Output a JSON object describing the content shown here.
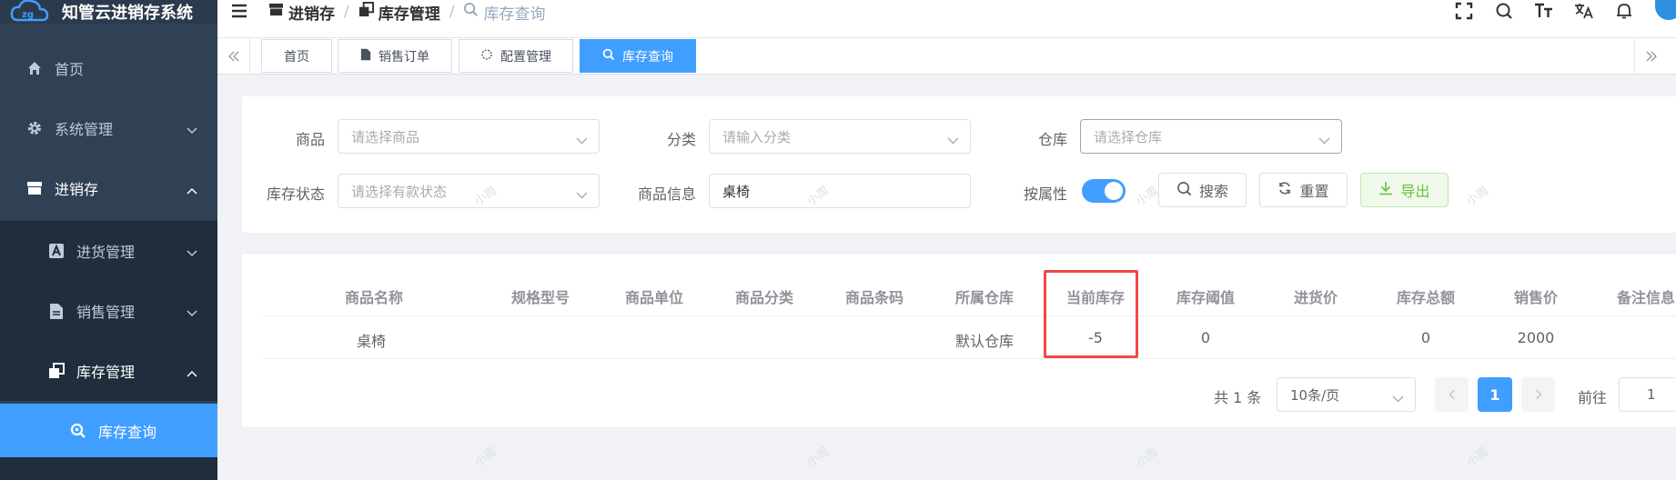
{
  "app": {
    "title": "知管云进销存系统"
  },
  "sidebar": {
    "items": [
      {
        "label": "首页",
        "icon": "home-icon"
      },
      {
        "label": "系统管理",
        "icon": "gear-icon"
      },
      {
        "label": "进销存",
        "icon": "store-icon"
      },
      {
        "label": "进货管理",
        "icon": "purchase-icon"
      },
      {
        "label": "销售管理",
        "icon": "document-icon"
      },
      {
        "label": "库存管理",
        "icon": "copy-icon"
      },
      {
        "label": "库存查询",
        "icon": "search-icon"
      }
    ]
  },
  "breadcrumb": {
    "items": [
      "进销存",
      "库存管理",
      "库存查询"
    ]
  },
  "tags": [
    "首页",
    "销售订单",
    "配置管理",
    "库存查询"
  ],
  "filters": {
    "product_label": "商品",
    "product_placeholder": "请选择商品",
    "category_label": "分类",
    "category_placeholder": "请输入分类",
    "warehouse_label": "仓库",
    "warehouse_placeholder": "请选择仓库",
    "status_label": "库存状态",
    "status_placeholder": "请选择有款状态",
    "info_label": "商品信息",
    "info_value": "桌椅",
    "by_attr_label": "按属性",
    "search_label": "搜索",
    "reset_label": "重置",
    "export_label": "导出"
  },
  "table": {
    "headers": [
      "商品名称",
      "规格型号",
      "商品单位",
      "商品分类",
      "商品条码",
      "所属仓库",
      "当前库存",
      "库存阈值",
      "进货价",
      "库存总额",
      "销售价",
      "备注信息"
    ],
    "rows": [
      {
        "name": "桌椅",
        "spec": "",
        "unit": "",
        "category": "",
        "barcode": "",
        "warehouse": "默认仓库",
        "stock": "-5",
        "threshold": "0",
        "purchase_price": "",
        "total": "0",
        "sale_price": "2000",
        "remark": ""
      }
    ]
  },
  "pagination": {
    "total_text": "共 1 条",
    "page_size": "10条/页",
    "current_page": "1",
    "goto_label": "前往",
    "goto_value": "1"
  },
  "watermark": "小周",
  "colors": {
    "primary": "#409eff",
    "sidebar": "#304156",
    "highlight": "#f04848",
    "success": "#67c23a"
  }
}
